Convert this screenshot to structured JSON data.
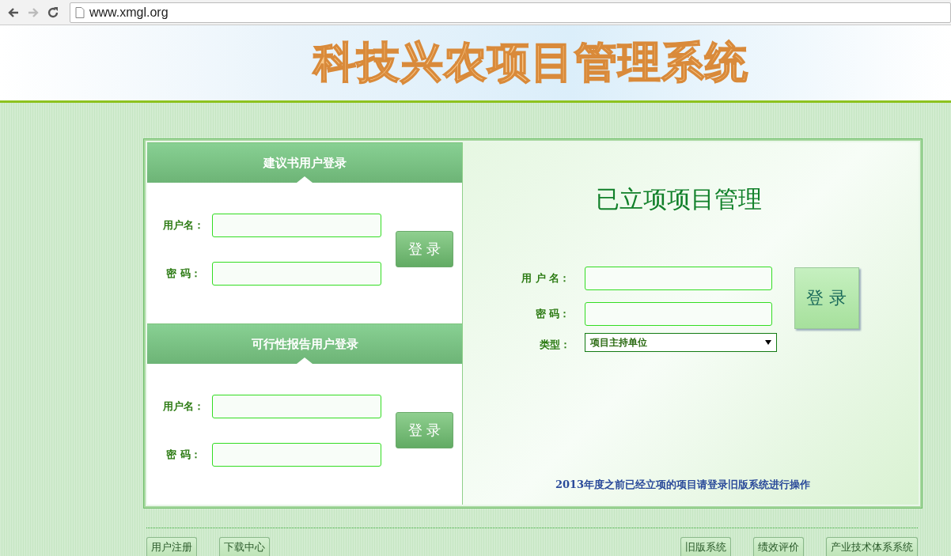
{
  "browser": {
    "url": "www.xmgl.org"
  },
  "header": {
    "title": "科技兴农项目管理系统"
  },
  "proposal_login": {
    "title": "建议书用户登录",
    "fields": [
      {
        "label": "用户名："
      },
      {
        "label": "密 码："
      }
    ],
    "button": "登 录"
  },
  "feasibility_login": {
    "title": "可行性报告用户登录",
    "fields": [
      {
        "label": "用户名："
      },
      {
        "label": "密 码："
      }
    ],
    "button": "登 录"
  },
  "project_management": {
    "title": "已立项项目管理",
    "fields": [
      {
        "label": "用 户 名："
      },
      {
        "label": "密 码："
      }
    ],
    "type_field": {
      "label": "类型：",
      "value": "项目主持单位"
    },
    "button": "登 录",
    "note": "2013年度之前已经立项的项目请登录旧版系统进行操作"
  },
  "footer": {
    "left_buttons": [
      "用户注册",
      "下载中心"
    ],
    "right_buttons": [
      "旧版系统",
      "绩效评价",
      "产业技术体系系统"
    ]
  }
}
